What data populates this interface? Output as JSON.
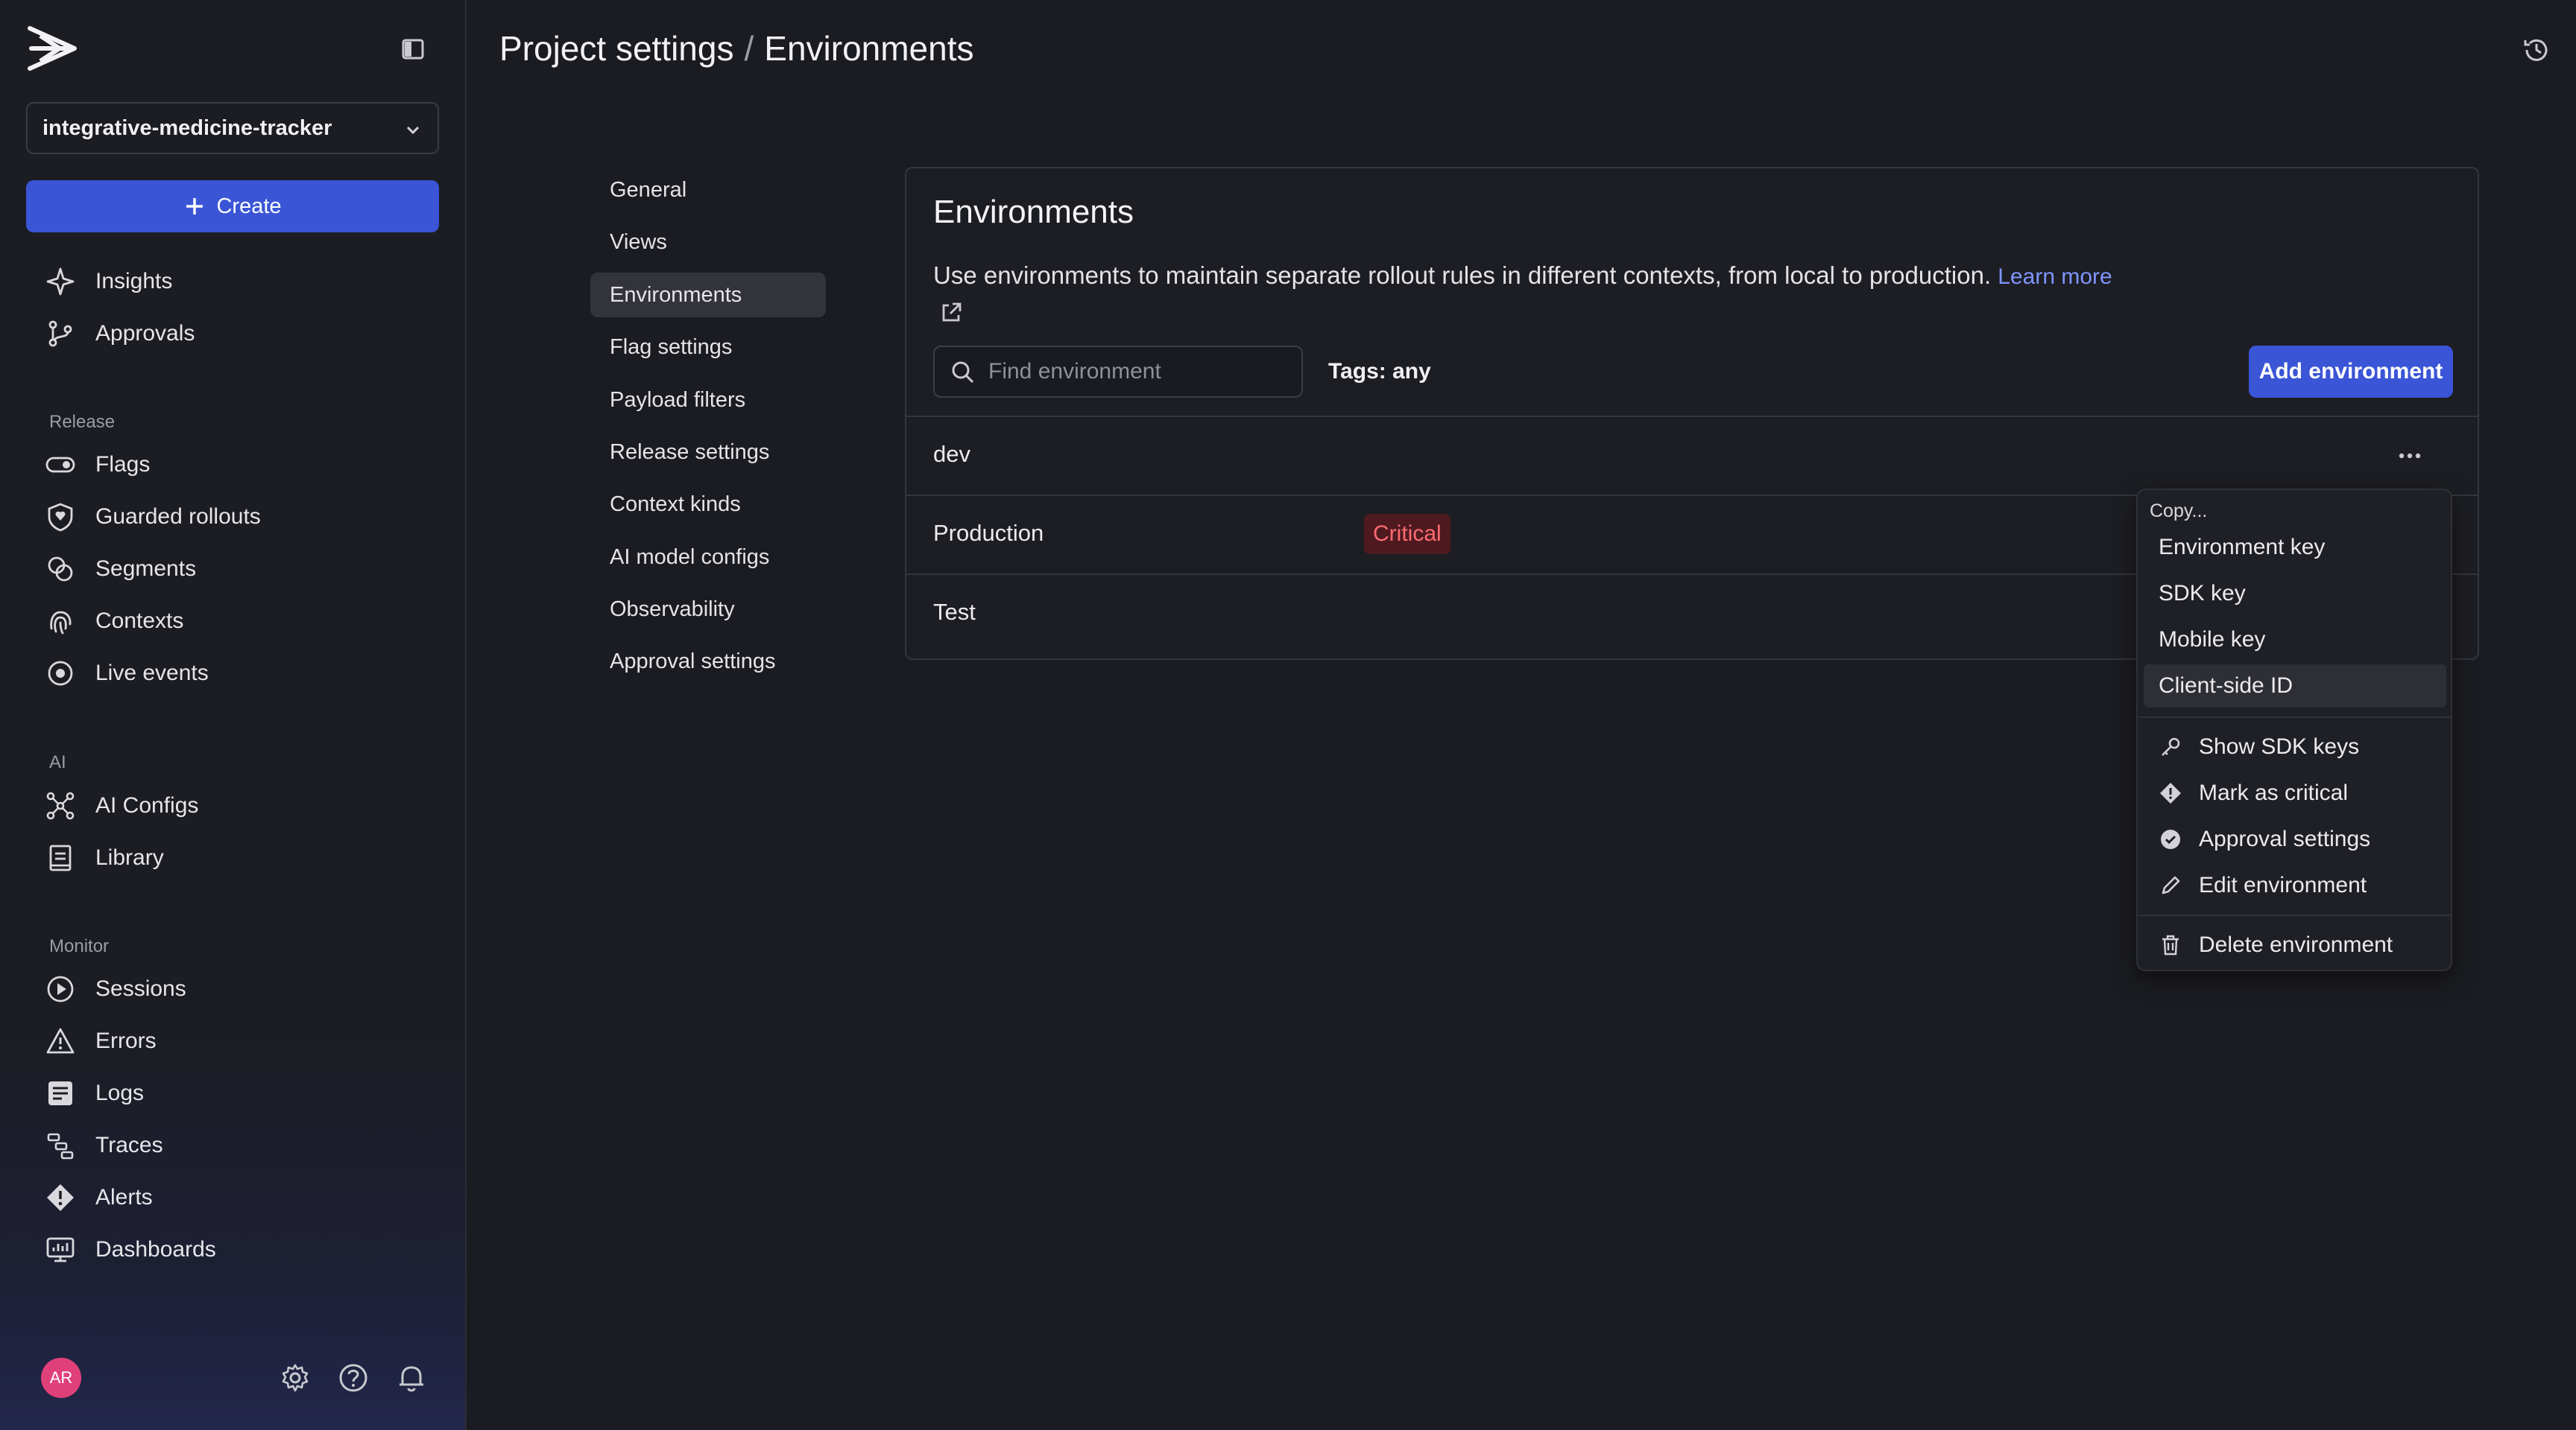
{
  "sidebar": {
    "project": "integrative-medicine-tracker",
    "create_label": "Create",
    "top_items": [
      {
        "label": "Insights",
        "icon": "sparkle-icon"
      },
      {
        "label": "Approvals",
        "icon": "branch-icon"
      }
    ],
    "release_label": "Release",
    "release_items": [
      {
        "label": "Flags",
        "icon": "toggle-icon"
      },
      {
        "label": "Guarded rollouts",
        "icon": "shield-icon"
      },
      {
        "label": "Segments",
        "icon": "segments-icon"
      },
      {
        "label": "Contexts",
        "icon": "fingerprint-icon"
      },
      {
        "label": "Live events",
        "icon": "live-icon"
      }
    ],
    "ai_label": "AI",
    "ai_items": [
      {
        "label": "AI Configs",
        "icon": "network-icon"
      },
      {
        "label": "Library",
        "icon": "book-icon"
      }
    ],
    "monitor_label": "Monitor",
    "monitor_items": [
      {
        "label": "Sessions",
        "icon": "play-icon"
      },
      {
        "label": "Errors",
        "icon": "warning-icon"
      },
      {
        "label": "Logs",
        "icon": "logs-icon"
      },
      {
        "label": "Traces",
        "icon": "traces-icon"
      },
      {
        "label": "Alerts",
        "icon": "alert-icon"
      },
      {
        "label": "Dashboards",
        "icon": "dashboard-icon"
      }
    ],
    "avatar_initials": "AR"
  },
  "header": {
    "parent": "Project settings",
    "separator": "/",
    "current": "Environments"
  },
  "settings_nav": [
    "General",
    "Views",
    "Environments",
    "Flag settings",
    "Payload filters",
    "Release settings",
    "Context kinds",
    "AI model configs",
    "Observability",
    "Approval settings"
  ],
  "settings_nav_active": "Environments",
  "panel": {
    "title": "Environments",
    "description": "Use environments to maintain separate rollout rules in different contexts, from local to production.",
    "learn_more": "Learn more",
    "search_placeholder": "Find environment",
    "tags_filter": "Tags: any",
    "add_button": "Add environment",
    "environments": [
      {
        "name": "dev",
        "badge": ""
      },
      {
        "name": "Production",
        "badge": "Critical"
      },
      {
        "name": "Test",
        "badge": ""
      }
    ]
  },
  "menu": {
    "header": "Copy...",
    "copy_items": [
      "Environment key",
      "SDK key",
      "Mobile key",
      "Client-side ID"
    ],
    "highlighted": "Client-side ID",
    "actions": [
      {
        "label": "Show SDK keys",
        "icon": "key-icon"
      },
      {
        "label": "Mark as critical",
        "icon": "diamond-alert-icon"
      },
      {
        "label": "Approval settings",
        "icon": "check-badge-icon"
      },
      {
        "label": "Edit environment",
        "icon": "pencil-icon"
      }
    ],
    "delete_label": "Delete environment"
  },
  "colors": {
    "accent": "#3a55d6",
    "link": "#7f95ff",
    "critical_bg": "#4e1a20",
    "critical_text": "#ff6b72",
    "avatar": "#e0407a"
  }
}
